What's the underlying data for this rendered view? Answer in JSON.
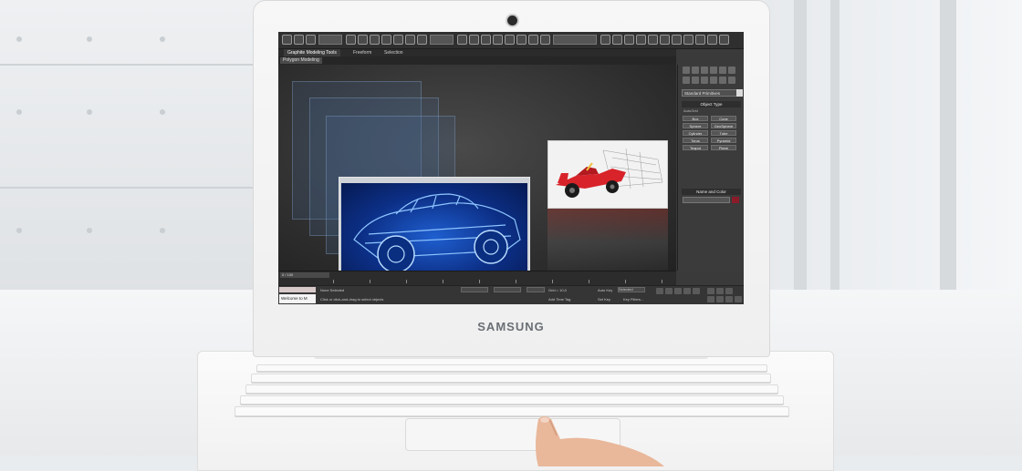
{
  "brand": {
    "name": "SAMSUNG"
  },
  "app": {
    "ribbon_tabs": [
      "Graphite Modeling Tools",
      "Freeform",
      "Selection"
    ],
    "sub_tab": "Polygon Modeling",
    "command_panel": {
      "dropdown_value": "Standard Primitives",
      "object_type_header": "Object Type",
      "autogrid_label": "AutoGrid",
      "buttons": [
        "Box",
        "Cone",
        "Sphere",
        "GeoSphere",
        "Cylinder",
        "Tube",
        "Torus",
        "Pyramid",
        "Teapot",
        "Plane"
      ],
      "name_color_header": "Name and Color"
    },
    "timeline": {
      "slider_label": "0 / 100"
    },
    "status": {
      "script_field": "Welcome to M",
      "selection_text": "None Selected",
      "prompt_text": "Click or click-and-drag to select objects",
      "grid_text": "Grid = 10,0",
      "add_time_tag": "Add Time Tag",
      "auto_key": "Auto Key",
      "selected": "Selected",
      "set_key": "Set Key",
      "key_filters": "Key Filters..."
    }
  },
  "colors": {
    "screen_bg": "#3a3a3a",
    "render_blue": "#1f5fd0",
    "car_red": "#d8232a",
    "laptop_white": "#f4f4f4"
  },
  "icons": {
    "webcam": "webcam-icon",
    "dropdown_arrow": "chevron-down-icon"
  }
}
